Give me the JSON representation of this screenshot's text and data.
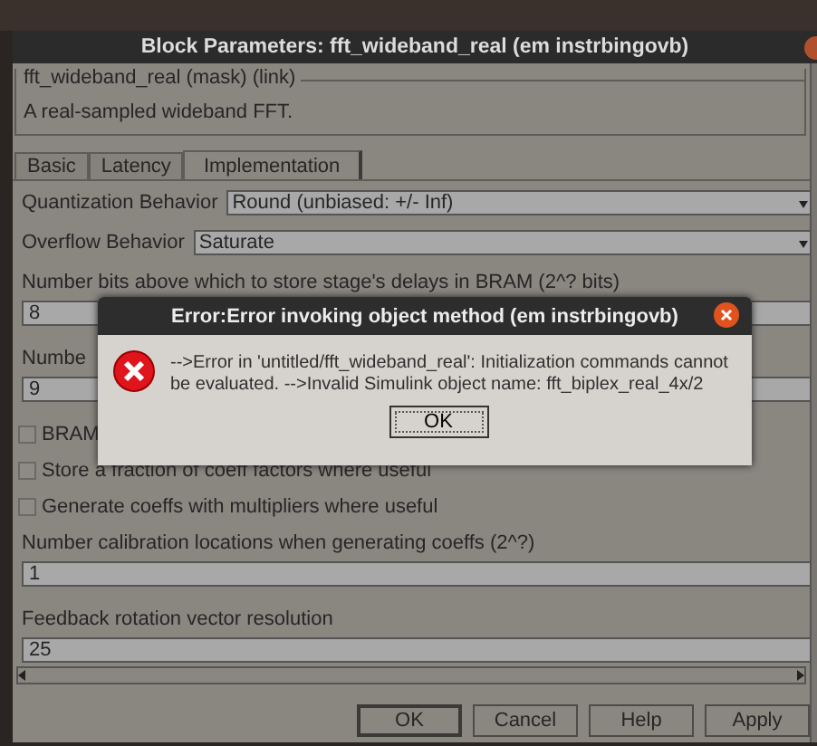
{
  "window": {
    "title": "Block Parameters: fft_wideband_real (em instrbingovb)"
  },
  "mask": {
    "title": "fft_wideband_real (mask) (link)",
    "description": "A real-sampled wideband FFT."
  },
  "tabs": [
    {
      "label": "Basic",
      "selected": false
    },
    {
      "label": "Latency",
      "selected": false
    },
    {
      "label": "Implementation",
      "selected": true
    }
  ],
  "params": [
    {
      "kind": "dropdown",
      "label": "Quantization Behavior",
      "value": "Round  (unbiased: +/- Inf)"
    },
    {
      "kind": "dropdown",
      "label": "Overflow Behavior",
      "value": "Saturate"
    },
    {
      "kind": "field",
      "label": "Number bits above which to store stage's delays in BRAM (2^? bits)",
      "value": "8"
    },
    {
      "kind": "field",
      "label": "Numbe",
      "value": "9"
    },
    {
      "kind": "checkbox",
      "label": "BRAM",
      "checked": false
    },
    {
      "kind": "checkbox",
      "label": "Store a fraction of coeff factors where useful",
      "checked": false
    },
    {
      "kind": "checkbox",
      "label": "Generate coeffs with multipliers where useful",
      "checked": false
    },
    {
      "kind": "field",
      "label": "Number calibration locations when generating coeffs (2^?)",
      "value": "1"
    },
    {
      "kind": "field",
      "label": "Feedback rotation vector resolution",
      "value": "25"
    }
  ],
  "buttons": [
    "OK",
    "Cancel",
    "Help",
    "Apply"
  ],
  "error_dialog": {
    "title": "Error:Error invoking object method (em instrbingovb)",
    "message": "-->Error in 'untitled/fft_wideband_real': Initialization commands cannot be evaluated. -->Invalid Simulink object name: fft_biplex_real_4x/2",
    "button": "OK"
  }
}
